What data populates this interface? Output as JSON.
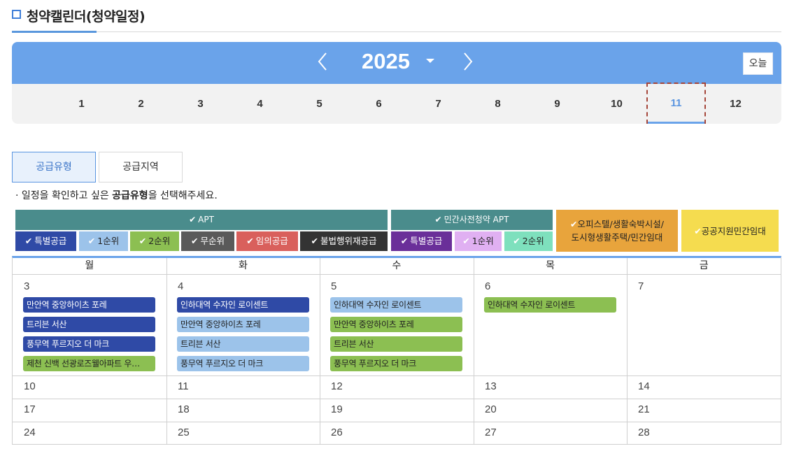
{
  "page": {
    "title": "청약캘린더(청약일정)"
  },
  "year_nav": {
    "year": "2025",
    "today_label": "오늘",
    "months": [
      "1",
      "2",
      "3",
      "4",
      "5",
      "6",
      "7",
      "8",
      "9",
      "10",
      "11",
      "12"
    ],
    "active_month": "11"
  },
  "tabs": [
    {
      "label": "공급유형",
      "active": true
    },
    {
      "label": "공급지역",
      "active": false
    }
  ],
  "notice": {
    "prefix": "· 일정을 확인하고 싶은 ",
    "bold": "공급유형",
    "suffix": "을 선택해주세요."
  },
  "check_icon": "✔",
  "categories": {
    "apt_header": "APT",
    "presale_header": "민간사전청약 APT",
    "apt_chips": [
      "특별공급",
      "1순위",
      "2순위",
      "무순위",
      "임의공급",
      "불법행위재공급"
    ],
    "presale_chips": [
      "특별공급",
      "1순위",
      "2순위"
    ],
    "officetel_line1": "오피스텔/생활숙박시설/",
    "officetel_line2": "도시형생활주택/민간임대",
    "public_rental": "공공지원민간임대"
  },
  "colors": {
    "apt_header": "#4a8c8c",
    "special": "#2f4aa6",
    "first": "#9cc3ea",
    "second": "#8cbf52",
    "no_rank": "#5a5a5a",
    "optional": "#d9605c",
    "illegal": "#333333",
    "presale_special": "#6a2f99",
    "presale_first": "#e0b0f2",
    "presale_second": "#7ee0bd",
    "officetel": "#e8a43c",
    "public_rental": "#f5dc4f",
    "accent": "#6aa3ea"
  },
  "calendar": {
    "weekdays": [
      "월",
      "화",
      "수",
      "목",
      "금"
    ],
    "weeks": [
      {
        "days": [
          {
            "num": "3",
            "events": [
              {
                "name": "만안역 중앙하이츠 포레",
                "type": "special"
              },
              {
                "name": "트리븐 서산",
                "type": "special"
              },
              {
                "name": "풍무역 푸르지오 더 마크",
                "type": "special"
              },
              {
                "name": "제천 신백 선광로즈웰아파트 우…",
                "type": "second"
              }
            ]
          },
          {
            "num": "4",
            "events": [
              {
                "name": "인하대역 수자인 로이센트",
                "type": "special"
              },
              {
                "name": "만안역 중앙하이츠 포레",
                "type": "first"
              },
              {
                "name": "트리븐 서산",
                "type": "first"
              },
              {
                "name": "풍무역 푸르지오 더 마크",
                "type": "first"
              }
            ]
          },
          {
            "num": "5",
            "events": [
              {
                "name": "인하대역 수자인 로이센트",
                "type": "first"
              },
              {
                "name": "만안역 중앙하이츠 포레",
                "type": "second"
              },
              {
                "name": "트리븐 서산",
                "type": "second"
              },
              {
                "name": "풍무역 푸르지오 더 마크",
                "type": "second"
              }
            ]
          },
          {
            "num": "6",
            "events": [
              {
                "name": "인하대역 수자인 로이센트",
                "type": "second"
              }
            ]
          },
          {
            "num": "7",
            "events": []
          }
        ]
      },
      {
        "days": [
          {
            "num": "10"
          },
          {
            "num": "11"
          },
          {
            "num": "12"
          },
          {
            "num": "13"
          },
          {
            "num": "14"
          }
        ]
      },
      {
        "days": [
          {
            "num": "17"
          },
          {
            "num": "18"
          },
          {
            "num": "19"
          },
          {
            "num": "20"
          },
          {
            "num": "21"
          }
        ]
      },
      {
        "days": [
          {
            "num": "24"
          },
          {
            "num": "25"
          },
          {
            "num": "26"
          },
          {
            "num": "27"
          },
          {
            "num": "28"
          }
        ]
      }
    ]
  }
}
